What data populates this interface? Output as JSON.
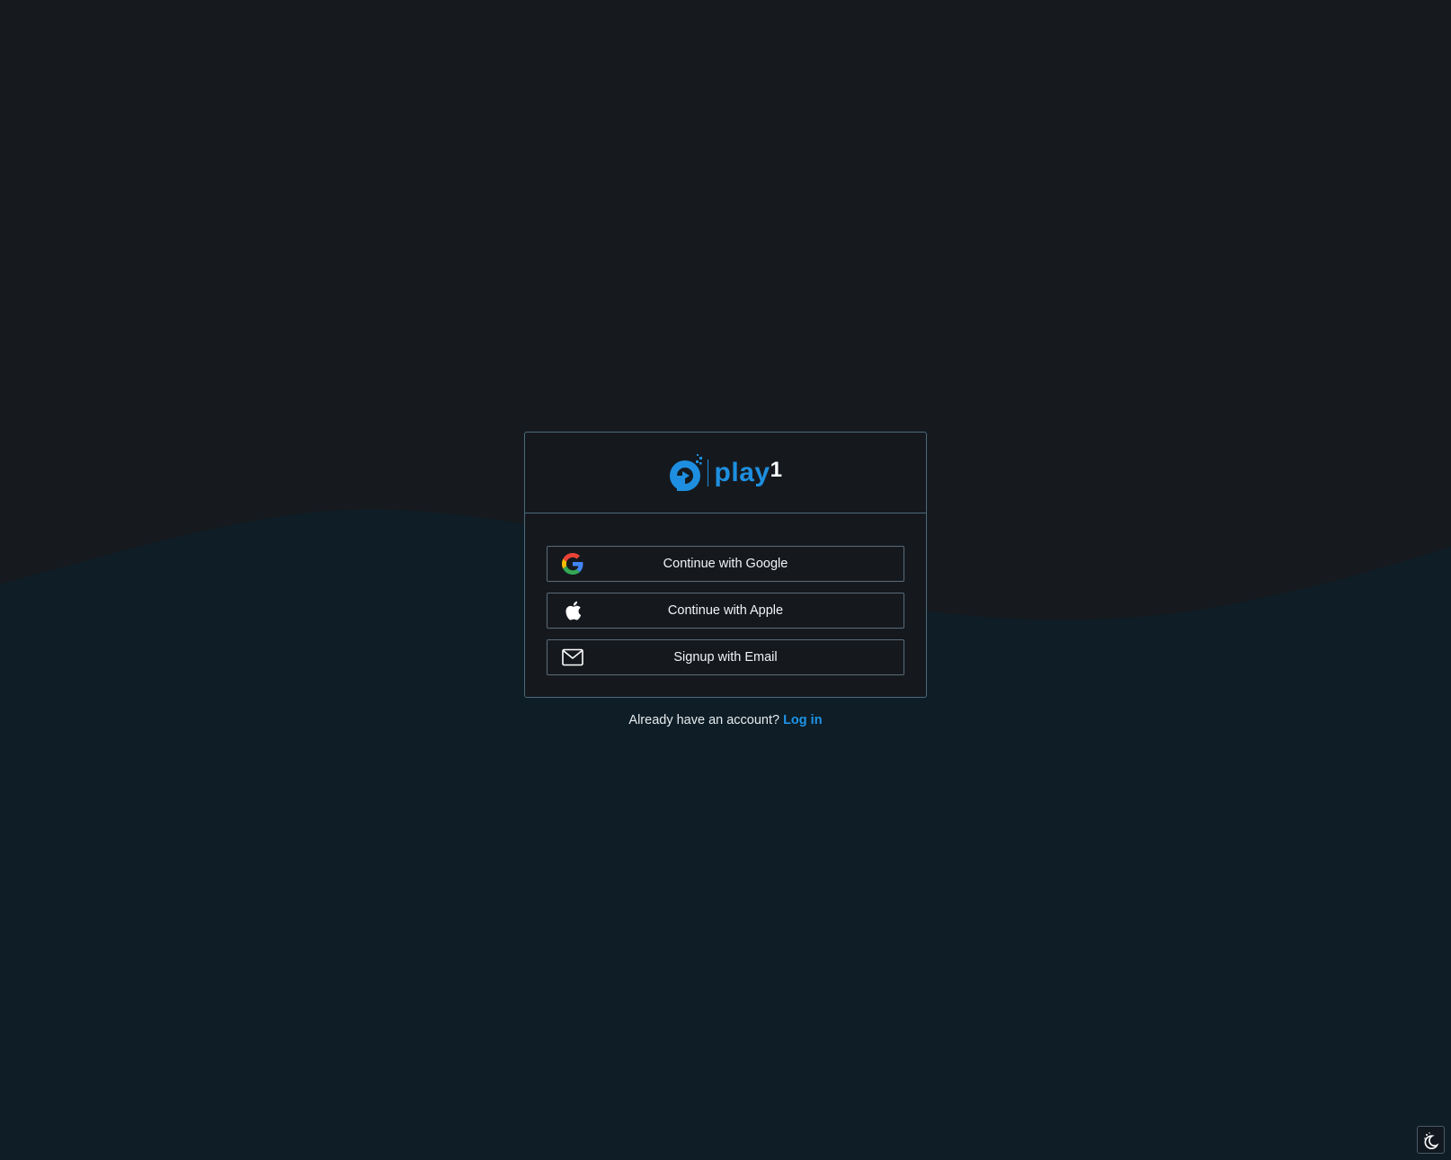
{
  "brand": {
    "name_main": "play",
    "name_suffix": "1",
    "logo_icon": "play1-logo-icon",
    "accent_color": "#1e8fe0"
  },
  "auth": {
    "google_label": "Continue with Google",
    "google_icon": "google-icon",
    "apple_label": "Continue with Apple",
    "apple_icon": "apple-icon",
    "email_label": "Signup with Email",
    "email_icon": "mail-icon"
  },
  "footer": {
    "prompt": "Already have an account?",
    "login_label": "Log in",
    "link_color": "#1e94e8"
  },
  "theme_toggle": {
    "icon": "moon-stars-icon"
  },
  "colors": {
    "background_top": "#161a1f",
    "background_wave": "#0e1d26",
    "card_border": "#4a6a7c"
  }
}
